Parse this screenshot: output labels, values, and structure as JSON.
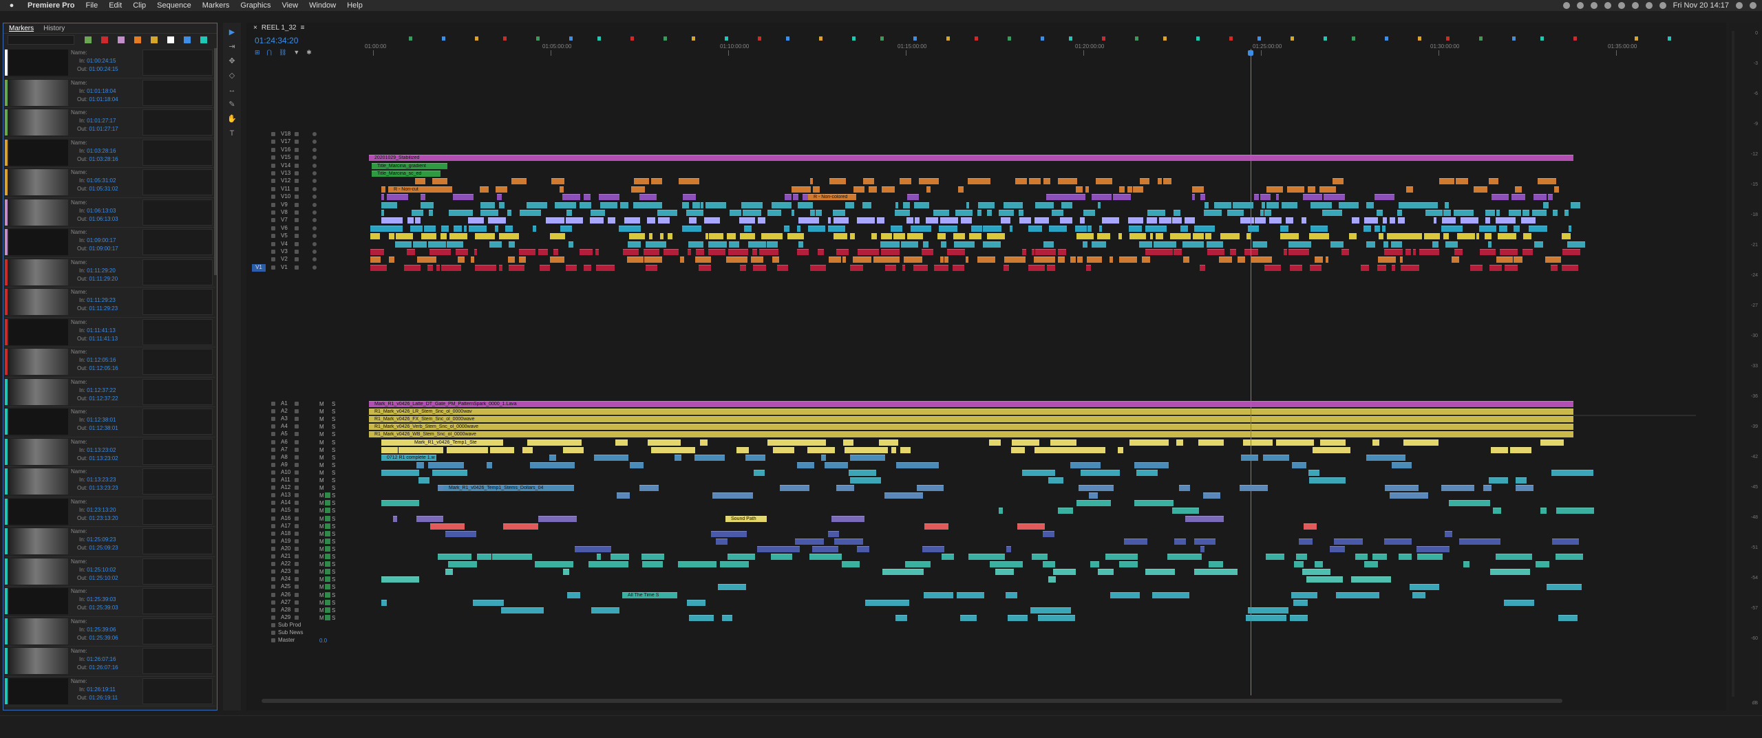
{
  "menubar": {
    "app": "Premiere Pro",
    "items": [
      "File",
      "Edit",
      "Clip",
      "Sequence",
      "Markers",
      "Graphics",
      "View",
      "Window",
      "Help"
    ],
    "datetime": "Fri Nov 20  14:17"
  },
  "markers_panel": {
    "tabs": [
      "Markers",
      "History"
    ],
    "name_label": "Name:",
    "in_label": "In:",
    "out_label": "Out:",
    "swatch_colors": [
      "#6aa84f",
      "#cc2b2b",
      "#c48ec7",
      "#e57c22",
      "#d9a42c",
      "#ffffff",
      "#3e8ee6",
      "#1ec8b5"
    ],
    "items": [
      {
        "in": "01:00:24:15",
        "out": "01:00:24:15",
        "color": "#ffffff"
      },
      {
        "in": "01:01:18:04",
        "out": "01:01:18:04",
        "color": "#6aa84f"
      },
      {
        "in": "01:01:27:17",
        "out": "01:01:27:17",
        "color": "#6aa84f"
      },
      {
        "in": "01:03:28:16",
        "out": "01:03:28:16",
        "color": "#d9a42c"
      },
      {
        "in": "01:05:31:02",
        "out": "01:05:31:02",
        "color": "#d9a42c"
      },
      {
        "in": "01:06:13:03",
        "out": "01:06:13:03",
        "color": "#c48ec7"
      },
      {
        "in": "01:09:00:17",
        "out": "01:09:00:17",
        "color": "#c48ec7"
      },
      {
        "in": "01:11:29:20",
        "out": "01:11:29:20",
        "color": "#cc2b2b"
      },
      {
        "in": "01:11:29:23",
        "out": "01:11:29:23",
        "color": "#cc2b2b"
      },
      {
        "in": "01:11:41:13",
        "out": "01:11:41:13",
        "color": "#cc2b2b"
      },
      {
        "in": "01:12:05:16",
        "out": "01:12:05:16",
        "color": "#cc2b2b"
      },
      {
        "in": "01:12:37:22",
        "out": "01:12:37:22",
        "color": "#1ec8b5"
      },
      {
        "in": "01:12:38:01",
        "out": "01:12:38:01",
        "color": "#1ec8b5"
      },
      {
        "in": "01:13:23:02",
        "out": "01:13:23:02",
        "color": "#1ec8b5"
      },
      {
        "in": "01:13:23:23",
        "out": "01:13:23:23",
        "color": "#1ec8b5"
      },
      {
        "in": "01:23:13:20",
        "out": "01:23:13:20",
        "color": "#1ec8b5"
      },
      {
        "in": "01:25:09:23",
        "out": "01:25:09:23",
        "color": "#1ec8b5"
      },
      {
        "in": "01:25:10:02",
        "out": "01:25:10:02",
        "color": "#1ec8b5"
      },
      {
        "in": "01:25:39:03",
        "out": "01:25:39:03",
        "color": "#1ec8b5"
      },
      {
        "in": "01:25:39:06",
        "out": "01:25:39:06",
        "color": "#1ec8b5"
      },
      {
        "in": "01:26:07:16",
        "out": "01:26:07:16",
        "color": "#1ec8b5"
      },
      {
        "in": "01:26:19:11",
        "out": "01:26:19:11",
        "color": "#1ec8b5"
      }
    ]
  },
  "timeline": {
    "sequence_tab": "REEL 1_32",
    "timecode": "01:24:34:20",
    "ruler_labels": [
      "01:00:00",
      "01:05:00:00",
      "01:10:00:00",
      "01:15:00:00",
      "01:20:00:00",
      "01:25:00:00",
      "01:30:00:00",
      "01:35:00:00"
    ],
    "video_tracks": [
      "V18",
      "V17",
      "V16",
      "V15",
      "V14",
      "V13",
      "V12",
      "V11",
      "V10",
      "V9",
      "V8",
      "V7",
      "V6",
      "V5",
      "V4",
      "V3",
      "V2",
      "V1"
    ],
    "audio_tracks": [
      "A1",
      "A2",
      "A3",
      "A4",
      "A5",
      "A6",
      "A7",
      "A8",
      "A9",
      "A10",
      "A11",
      "A12",
      "A13",
      "A14",
      "A15",
      "A16",
      "A17",
      "A18",
      "A19",
      "A20",
      "A21",
      "A22",
      "A23",
      "A24",
      "A25",
      "A26",
      "A27",
      "A28",
      "A29"
    ],
    "submix_tracks": [
      "Sub Prod",
      "Sub News",
      "Master"
    ],
    "master_value": "0.0",
    "source_patch": "V1",
    "mute_label": "M",
    "solo_label": "S",
    "clips": {
      "v15_label": "20201029_Stabilized",
      "v14_label": "Title_Marcina_gradient",
      "v13_label": "Title_Marcina_sc_ed",
      "v11_label": "R - Non-cut",
      "v10_label": "R - Non-colored",
      "a1_label": "Mark_R1_v0426_Latte_DT_Gate_PM_PatternSpark_0000_1.Lava",
      "a2_label": "R1_Mark_v0426_LR_Stem_Snc_ol_0000wav",
      "a3_label": "R1_Mark_v0426_FX_Stem_Snc_ol_0000wave",
      "a4_label": "R1_Mark_v0426_Verb_Stem_Snc_ol_0000wave",
      "a5_label": "R1_Mark_v0426_WB_Stem_Snc_ol_0000wave",
      "a6_label": "Mark_R1_v0426_Temp1_Ste",
      "a8_label": "0712 R1 complete 1.wav",
      "a12_label": "Mark_R1_v0426_Temp1_Stems_Dollars_04",
      "a16_label": "Sound Path",
      "a18_label": "All The Time S"
    }
  },
  "meters": {
    "db_labels": [
      "0",
      "-3",
      "-6",
      "-9",
      "-12",
      "-15",
      "-18",
      "-21",
      "-24",
      "-27",
      "-30",
      "-33",
      "-36",
      "-39",
      "-42",
      "-45",
      "-48",
      "-51",
      "-54",
      "-57",
      "-60"
    ],
    "bottom_label": "dB"
  }
}
